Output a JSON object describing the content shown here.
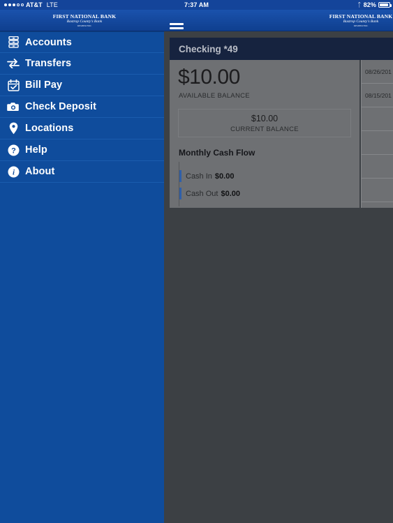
{
  "status_bar": {
    "signal_dots_filled": 3,
    "signal_dots_empty": 2,
    "carrier": "AT&T",
    "network": "LTE",
    "time": "7:37 AM",
    "bluetooth_icon": "bluetooth-icon",
    "battery_percent": "82%",
    "battery_level": 82
  },
  "navbar": {
    "menu_icon": "hamburger-menu-icon",
    "logo": {
      "line1": "FIRST NATIONAL BANK",
      "line2": "Bastrop County's Bank",
      "line3": "MEMBER FDIC"
    }
  },
  "sidebar": {
    "items": [
      {
        "label": "Accounts",
        "icon": "accounts-drawer-icon"
      },
      {
        "label": "Transfers",
        "icon": "transfer-arrows-icon"
      },
      {
        "label": "Bill Pay",
        "icon": "calendar-check-icon"
      },
      {
        "label": "Check Deposit",
        "icon": "camera-icon"
      },
      {
        "label": "Locations",
        "icon": "map-pin-icon"
      },
      {
        "label": "Help",
        "icon": "question-circle-icon"
      },
      {
        "label": "About",
        "icon": "info-circle-icon"
      }
    ]
  },
  "account": {
    "header_title": "Checking *49",
    "available_balance": "$10.00",
    "available_balance_label": "AVAILABLE BALANCE",
    "current_balance": "$10.00",
    "current_balance_label": "CURRENT BALANCE",
    "cash_flow": {
      "title": "Monthly Cash Flow",
      "rows": [
        {
          "name": "Cash In",
          "value": "$0.00"
        },
        {
          "name": "Cash Out",
          "value": "$0.00"
        }
      ]
    }
  },
  "transactions": {
    "rows": [
      {
        "date": "08/26/201"
      },
      {
        "date": "08/15/201"
      },
      {
        "date": ""
      },
      {
        "date": ""
      },
      {
        "date": ""
      },
      {
        "date": ""
      }
    ]
  },
  "colors": {
    "brand_blue": "#0f4c9c",
    "navbar_blue": "#14449a",
    "header_navy": "#16233f",
    "panel_gray": "#6e7073",
    "overlay_gray": "#3c4044",
    "accent_bar": "#2f5fa8"
  }
}
